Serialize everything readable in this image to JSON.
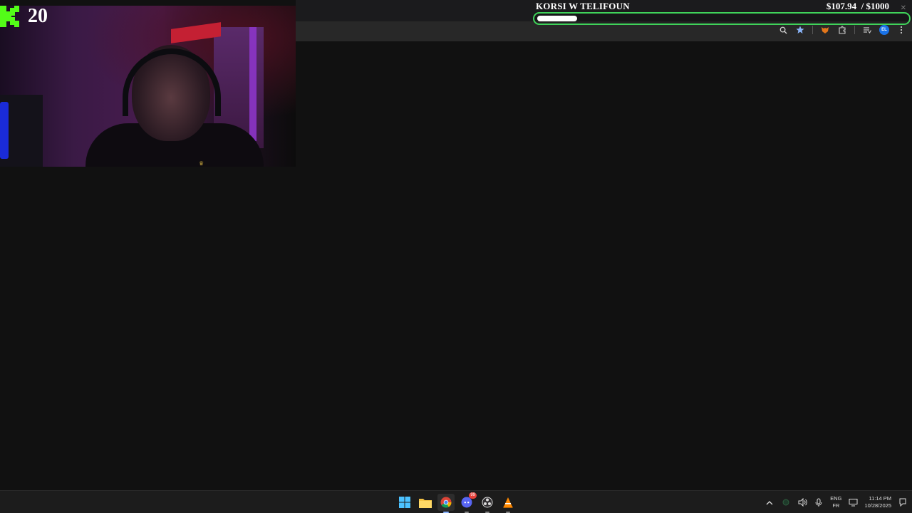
{
  "overlay": {
    "kick_count": "20",
    "goal": {
      "title": "KORSI W TELIFOUN",
      "amount_text": "$107.94  / $1000",
      "current": 107.94,
      "target": 1000,
      "color": "#3fd35a"
    }
  },
  "browser": {
    "toolbar_icons": [
      "zoom-icon",
      "bookmark-star-icon",
      "extension-fox-icon",
      "extensions-puzzle-icon",
      "reading-list-icon",
      "profile-avatar-icon",
      "menu-kebab-icon"
    ],
    "profile_initials": "EL",
    "close_glyph": "✕"
  },
  "taskbar": {
    "apps": [
      "windows-start-icon",
      "file-explorer-icon",
      "chrome-icon",
      "discord-icon",
      "obs-icon",
      "vlc-icon"
    ],
    "discord_badge": "99",
    "tray": {
      "lang_top": "ENG",
      "lang_bottom": "FR",
      "time": "11:14 PM",
      "date": "10/28/2025"
    }
  }
}
